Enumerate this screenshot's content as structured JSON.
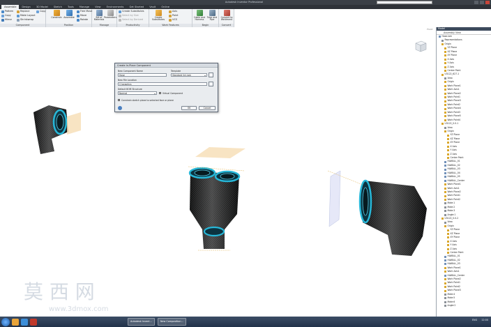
{
  "window": {
    "title": "Autodesk Inventor Professional",
    "search_placeholder": "Type a keyword or phrase"
  },
  "menu_tabs": [
    "Assemble",
    "Design",
    "3D Model",
    "Sketch",
    "Tools",
    "Manage",
    "View",
    "Environments",
    "Get Started",
    "Vault",
    "Online"
  ],
  "ribbon": {
    "component": {
      "label": "Component",
      "place": "Place",
      "create": "Create",
      "items_a": [
        "Pattern",
        "Copy",
        "Mirror"
      ],
      "items_b": [
        "Replace",
        "Make Layout",
        "Shrinkwrap"
      ],
      "items_c": [
        "Copy"
      ]
    },
    "position": {
      "label": "Position",
      "constrain": "Constrain",
      "assemble": "Assemble",
      "items": [
        "Free Move",
        "Move",
        "Rotate"
      ]
    },
    "manage": {
      "label": "Manage",
      "bom": "Bill of Materials",
      "params": "Parameters"
    },
    "productivity": {
      "label": "Productivity",
      "items": [
        "Create Substitutes",
        "Select by Size",
        "Select by Derived"
      ]
    },
    "work_features": {
      "label": "Work Features",
      "create_substitutes": "Create Substitutes",
      "items": [
        "Axis",
        "Point",
        "UCS"
      ]
    },
    "begin": {
      "label": "Begin",
      "cable": "Cable and Harness",
      "tube": "Tube and Pipe"
    },
    "convert": {
      "label": "Convert",
      "conv": "Convert to Weldment"
    }
  },
  "viewport": {
    "label": "Front"
  },
  "dialog": {
    "title": "Create In-Place Component",
    "name_label": "New Component Name",
    "name_value": "Hose",
    "template_label": "Template",
    "template_value": "Standard (in).iam",
    "location_label": "New File Location",
    "location_value": "C:\\graphics",
    "bom_label": "Default BOM Structure",
    "bom_value": "Normal",
    "virtual_label": "Virtual Component",
    "constrain_label": "Constrain sketch plane to selected face or plane",
    "ok": "OK",
    "cancel": "Cancel"
  },
  "browser": {
    "title": "Model",
    "view_label": "Assembly View",
    "nodes": [
      {
        "t": "Hose.iam",
        "d": 0,
        "c": "#6f8fb8"
      },
      {
        "t": "Representations",
        "d": 1,
        "c": "#8a8f96"
      },
      {
        "t": "Origin",
        "d": 1,
        "c": "#d9a62a"
      },
      {
        "t": "YZ Plane",
        "d": 2,
        "c": "#d9a62a"
      },
      {
        "t": "XZ Plane",
        "d": 2,
        "c": "#d9a62a"
      },
      {
        "t": "XY Plane",
        "d": 2,
        "c": "#d9a62a"
      },
      {
        "t": "X Axis",
        "d": 2,
        "c": "#d9a62a"
      },
      {
        "t": "Y Axis",
        "d": 2,
        "c": "#d9a62a"
      },
      {
        "t": "Z Axis",
        "d": 2,
        "c": "#d9a62a"
      },
      {
        "t": "Center Point",
        "d": 2,
        "c": "#d9a62a"
      },
      {
        "t": "U3122_627-1",
        "d": 1,
        "c": "#d9a62a"
      },
      {
        "t": "View",
        "d": 2,
        "c": "#8a8f96"
      },
      {
        "t": "Origin",
        "d": 2,
        "c": "#d9a62a"
      },
      {
        "t": "Work Plane1",
        "d": 2,
        "c": "#d9a62a"
      },
      {
        "t": "Work Axis1",
        "d": 2,
        "c": "#d9a62a"
      },
      {
        "t": "Work Plane2",
        "d": 2,
        "c": "#d9a62a"
      },
      {
        "t": "Work Point1",
        "d": 2,
        "c": "#d9a62a"
      },
      {
        "t": "Work Plane3",
        "d": 2,
        "c": "#d9a62a"
      },
      {
        "t": "Work Point2",
        "d": 2,
        "c": "#d9a62a"
      },
      {
        "t": "Work Plane4",
        "d": 2,
        "c": "#d9a62a"
      },
      {
        "t": "Work Point3",
        "d": 2,
        "c": "#d9a62a"
      },
      {
        "t": "Work Plane5",
        "d": 2,
        "c": "#d9a62a"
      },
      {
        "t": "Work Point4",
        "d": 2,
        "c": "#d9a62a"
      },
      {
        "t": "U3122_0.0-1",
        "d": 1,
        "c": "#d9a62a"
      },
      {
        "t": "View",
        "d": 2,
        "c": "#8a8f96"
      },
      {
        "t": "Origin",
        "d": 2,
        "c": "#d9a62a"
      },
      {
        "t": "YZ Plane",
        "d": 3,
        "c": "#d9a62a"
      },
      {
        "t": "XZ Plane",
        "d": 3,
        "c": "#d9a62a"
      },
      {
        "t": "XY Plane",
        "d": 3,
        "c": "#d9a62a"
      },
      {
        "t": "X Axis",
        "d": 3,
        "c": "#d9a62a"
      },
      {
        "t": "Y Axis",
        "d": 3,
        "c": "#d9a62a"
      },
      {
        "t": "Z Axis",
        "d": 3,
        "c": "#d9a62a"
      },
      {
        "t": "Center Point",
        "d": 3,
        "c": "#d9a62a"
      },
      {
        "t": "HAWALL_01",
        "d": 2,
        "c": "#6f8fb8"
      },
      {
        "t": "HAWALL_02",
        "d": 2,
        "c": "#6f8fb8"
      },
      {
        "t": "HAWALL_03",
        "d": 2,
        "c": "#6f8fb8"
      },
      {
        "t": "HAWALL_04",
        "d": 2,
        "c": "#6f8fb8"
      },
      {
        "t": "HAWALL_05",
        "d": 2,
        "c": "#6f8fb8"
      },
      {
        "t": "HAWALL_Center",
        "d": 2,
        "c": "#6f8fb8"
      },
      {
        "t": "Work Plane1",
        "d": 2,
        "c": "#d9a62a"
      },
      {
        "t": "Work Axis1",
        "d": 2,
        "c": "#d9a62a"
      },
      {
        "t": "Work Plane2",
        "d": 2,
        "c": "#d9a62a"
      },
      {
        "t": "Work Point1",
        "d": 2,
        "c": "#d9a62a"
      },
      {
        "t": "Work Point2",
        "d": 2,
        "c": "#d9a62a"
      },
      {
        "t": "Mate:1",
        "d": 2,
        "c": "#8a8f96"
      },
      {
        "t": "Mate:2",
        "d": 2,
        "c": "#8a8f96"
      },
      {
        "t": "Mate:3",
        "d": 2,
        "c": "#8a8f96"
      },
      {
        "t": "Angle:1",
        "d": 2,
        "c": "#8a8f96"
      },
      {
        "t": "U3122_0.0-2",
        "d": 1,
        "c": "#d9a62a"
      },
      {
        "t": "View",
        "d": 2,
        "c": "#8a8f96"
      },
      {
        "t": "Origin",
        "d": 2,
        "c": "#d9a62a"
      },
      {
        "t": "YZ Plane",
        "d": 3,
        "c": "#d9a62a"
      },
      {
        "t": "XZ Plane",
        "d": 3,
        "c": "#d9a62a"
      },
      {
        "t": "XY Plane",
        "d": 3,
        "c": "#d9a62a"
      },
      {
        "t": "X Axis",
        "d": 3,
        "c": "#d9a62a"
      },
      {
        "t": "Y Axis",
        "d": 3,
        "c": "#d9a62a"
      },
      {
        "t": "Z Axis",
        "d": 3,
        "c": "#d9a62a"
      },
      {
        "t": "Center Point",
        "d": 3,
        "c": "#d9a62a"
      },
      {
        "t": "HAWALL_01",
        "d": 2,
        "c": "#6f8fb8"
      },
      {
        "t": "HAWALL_02",
        "d": 2,
        "c": "#6f8fb8"
      },
      {
        "t": "HAWALL_03",
        "d": 2,
        "c": "#6f8fb8"
      },
      {
        "t": "Work Plane1",
        "d": 2,
        "c": "#d9a62a"
      },
      {
        "t": "Work Axis1",
        "d": 2,
        "c": "#d9a62a"
      },
      {
        "t": "HAWALL_Center",
        "d": 2,
        "c": "#6f8fb8"
      },
      {
        "t": "Work Plane2",
        "d": 2,
        "c": "#d9a62a"
      },
      {
        "t": "Work Point1",
        "d": 2,
        "c": "#d9a62a"
      },
      {
        "t": "Work Point2",
        "d": 2,
        "c": "#d9a62a"
      },
      {
        "t": "Work Plane3",
        "d": 2,
        "c": "#d9a62a"
      },
      {
        "t": "Mate:4",
        "d": 2,
        "c": "#8a8f96"
      },
      {
        "t": "Mate:5",
        "d": 2,
        "c": "#8a8f96"
      },
      {
        "t": "Mate:6",
        "d": 2,
        "c": "#8a8f96"
      },
      {
        "t": "Angle:2",
        "d": 2,
        "c": "#8a8f96"
      }
    ]
  },
  "watermark": {
    "text": "莫 西 网",
    "url": "www.3dmox.com"
  },
  "taskbar": {
    "tasks": [
      "Autodesk Invent...",
      "New Composition..."
    ],
    "lang": "ENG",
    "time": "12:00"
  },
  "colors": {
    "accent": "#2c7fb8",
    "hose_cyan": "#27b7d8",
    "plane_fill": "#f7dfb8"
  }
}
